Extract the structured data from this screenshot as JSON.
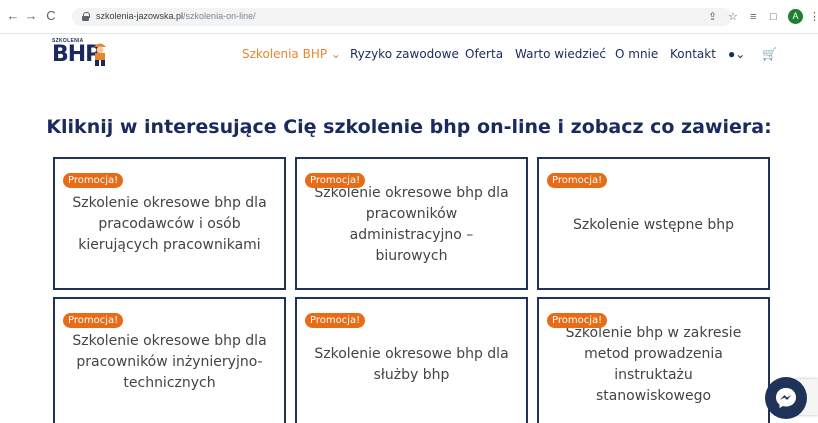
{
  "browser": {
    "url_domain": "szkolenia-jazowska.pl",
    "url_path": "/szkolenia-on-line/",
    "profile_initial": "A"
  },
  "header": {
    "logo_small": "SZKOLENIA",
    "logo_text": "BHP",
    "menu": [
      {
        "label": "Szkolenia BHP ⌄",
        "active": true
      },
      {
        "label": "Ryzyko zawodowe",
        "active": false
      },
      {
        "label": "Oferta",
        "active": false
      },
      {
        "label": "Warto wiedzieć",
        "active": false
      },
      {
        "label": "O mnie",
        "active": false
      },
      {
        "label": "Kontakt",
        "active": false
      }
    ]
  },
  "main": {
    "headline": "Kliknij w interesujące Cię szkolenie bhp on-line i zobacz co zawiera:",
    "cards": [
      {
        "badge": "Promocja!",
        "lines": [
          "Szkolenie okresowe bhp dla",
          "pracodawców i osób",
          "kierujących pracownikami"
        ]
      },
      {
        "badge": "Promocja!",
        "lines": [
          "Szkolenie okresowe bhp dla",
          "pracowników",
          "administracyjno –",
          "biurowych"
        ]
      },
      {
        "badge": "Promocja!",
        "lines": [
          "Szkolenie wstępne bhp"
        ]
      },
      {
        "badge": "Promocja!",
        "lines": [
          "Szkolenie okresowe bhp dla",
          "pracowników inżynieryjno-",
          "technicznych"
        ]
      },
      {
        "badge": "Promocja!",
        "lines": [
          "Szkolenie okresowe bhp dla",
          "służby bhp"
        ]
      },
      {
        "badge": "Promocja!",
        "lines": [
          "Szkolenie bhp w zakresie",
          "metod prowadzenia",
          "instruktażu",
          "stanowiskowego"
        ]
      }
    ]
  },
  "colors": {
    "brand_navy": "#1f3358",
    "accent_orange": "#e8862f",
    "badge_orange": "#e86b17"
  },
  "icons": [
    "back-arrow-icon",
    "forward-arrow-icon",
    "reload-icon",
    "lock-icon",
    "share-icon",
    "star-icon",
    "playlist-icon",
    "split-window-icon",
    "user-account-icon",
    "cart-icon",
    "messenger-icon"
  ]
}
